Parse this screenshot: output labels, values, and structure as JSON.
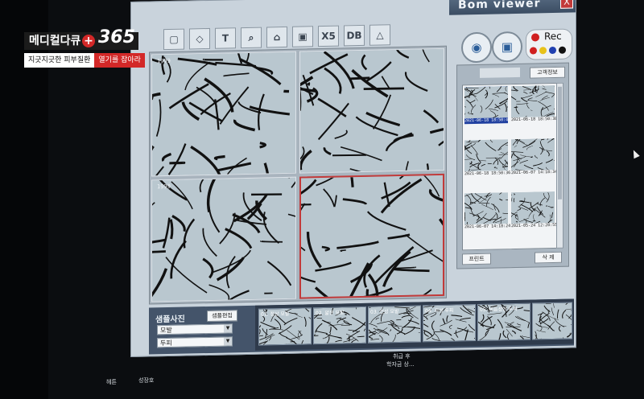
{
  "app": {
    "title": "Bom viewer",
    "close_label": "X"
  },
  "toolbar": {
    "x5_label": "X5",
    "db_label": "DB",
    "text_label": "T"
  },
  "viewer": {
    "stamps": [
      "1999",
      "",
      "1999",
      ""
    ]
  },
  "recorder": {
    "label": "Rec",
    "colors": [
      "#d02020",
      "#e8c21a",
      "#2040b0",
      "#111111"
    ]
  },
  "panel": {
    "info_button": "고객정보",
    "print_button": "프린트",
    "delete_button": "삭 제",
    "thumbnails": [
      {
        "caption": "2021-06-18 18:50:40",
        "selected": true
      },
      {
        "caption": "2021-06-18 18:50:38",
        "selected": false
      },
      {
        "caption": "2021-06-18 18:50:36",
        "selected": false
      },
      {
        "caption": "2021-06-07 14:18:34",
        "selected": false
      },
      {
        "caption": "2021-06-07 14:18:24",
        "selected": false
      },
      {
        "caption": "2021-05-24 12:28:55",
        "selected": false
      }
    ]
  },
  "samples": {
    "title": "샘플사진",
    "edit_button": "샘플편집",
    "select1": "모발",
    "select2": "두피",
    "items": [
      "01. 정상 모발",
      "02. 얇은 모발",
      "03. 건성 모발",
      "04. 지성 두피",
      "05. 비듬성인 두피"
    ]
  },
  "logo": {
    "brand": "메디컬다큐",
    "number": "365",
    "subtitle1": "지긋지긋한 피부질환",
    "subtitle2": "열기를 잡아라"
  },
  "below": {
    "left": "헤튼",
    "mid": "성장호",
    "center1": "취급 후",
    "center2": "학자금 상..."
  }
}
